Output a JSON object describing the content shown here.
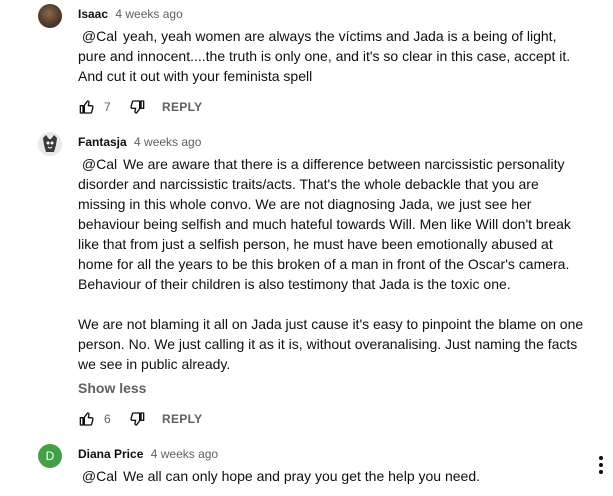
{
  "comments": [
    {
      "author": "Isaac",
      "time": "4 weeks ago",
      "mention": "@Cal",
      "paragraphs": [
        "yeah, yeah women are always the víctims and Jada is a being of light, pure and innocent....the truth is only one, and it's so clear in this case, accept it. And cut it out with your feminista spell"
      ],
      "likes": "7",
      "reply_label": "REPLY"
    },
    {
      "author": "Fantasja",
      "time": "4 weeks ago",
      "mention": "@Cal",
      "paragraphs": [
        "We are aware that there is a difference between narcissistic personality disorder and narcissistic traits/acts. That's the whole debackle that you are missing in this whole convo. We are not diagnosing Jada, we just see her behaviour being selfish and much hateful towards Will. Men like Will don't break like that from just a selfish person, he must have been emotionally abused at home for all the years to be this broken of a man in front of the Oscar's camera. Behaviour of their children is also testimony that Jada is the toxic one.",
        "We are not blaming it all on Jada just cause it's easy to pinpoint the blame on one person. No. We just calling it as it is, without overanalising. Just naming the facts we see in public already."
      ],
      "show_less": "Show less",
      "likes": "6",
      "reply_label": "REPLY"
    },
    {
      "author": "Diana Price",
      "avatar_letter": "D",
      "time": "4 weeks ago",
      "mention": "@Cal",
      "paragraphs": [
        "We all can only hope and pray you get the help you need."
      ]
    }
  ],
  "icons": {
    "like": "thumbs-up-icon",
    "dislike": "thumbs-down-icon",
    "menu": "more-vertical-icon"
  },
  "colors": {
    "avatar_diana": "#43a047",
    "secondary_text": "#606060"
  }
}
